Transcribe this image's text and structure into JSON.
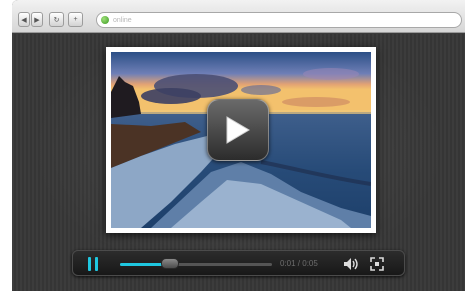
{
  "browser": {
    "address": "online",
    "buttons": [
      {
        "name": "back-button",
        "glyph": "◀"
      },
      {
        "name": "forward-button",
        "glyph": "▶"
      },
      {
        "name": "reload-button",
        "glyph": "↻"
      },
      {
        "name": "add-tab-button",
        "glyph": "+"
      }
    ]
  },
  "player": {
    "state": "paused",
    "progress_fraction": 0.33,
    "time_display": "0:01 / 0:05",
    "accent_color": "#1fc7e0",
    "icons": [
      "play-icon",
      "pause-icon",
      "volume-icon",
      "fullscreen-icon"
    ]
  },
  "video": {
    "thumbnail_subject": "beach-sunset"
  }
}
